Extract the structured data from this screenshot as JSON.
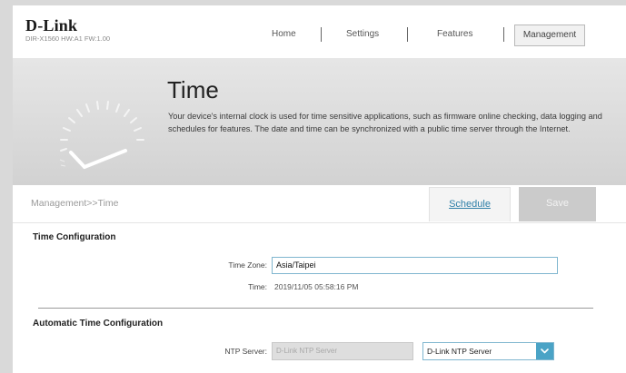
{
  "header": {
    "logo": "D-Link",
    "model": "DIR-X1560 HW:A1 FW:1.00",
    "nav": [
      "Home",
      "Settings",
      "Features",
      "Management"
    ],
    "active_nav": "Management"
  },
  "hero": {
    "title": "Time",
    "description": "Your device's internal clock is used for time sensitive applications, such as firmware online checking, data logging and schedules for features. The date and time can be synchronized with a public time server through the Internet."
  },
  "toolbar": {
    "breadcrumb": "Management>>Time",
    "schedule_label": "Schedule",
    "save_label": "Save"
  },
  "time_config": {
    "title": "Time Configuration",
    "timezone_label": "Time Zone:",
    "timezone_value": "Asia/Taipei",
    "time_label": "Time:",
    "time_value": "2019/11/05 05:58:16 PM"
  },
  "auto_time": {
    "title": "Automatic Time Configuration",
    "ntp_label": "NTP Server:",
    "ntp_placeholder": "D-Link NTP Server",
    "ntp_select": "D-Link NTP Server"
  },
  "icons": {
    "clock": "clock-icon",
    "dropdown": "chevron-down-icon"
  },
  "colors": {
    "accent": "#4aa3c6",
    "link": "#2f7fa8",
    "save_disabled": "#cbcbcb"
  }
}
